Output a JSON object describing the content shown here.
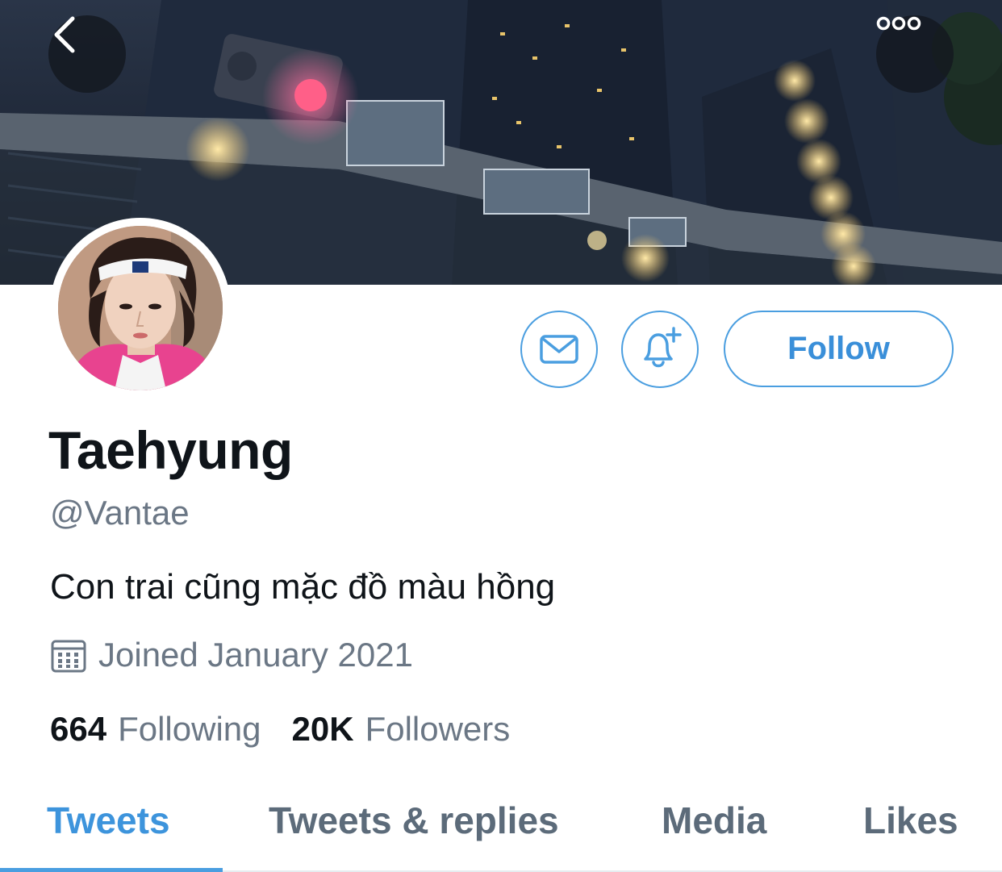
{
  "header": {
    "back_icon": "chevron-left-icon",
    "more_icon": "more-dots-icon"
  },
  "profile": {
    "display_name": "Taehyung",
    "handle": "@Vantae",
    "bio": "Con trai cũng mặc đồ màu hồng",
    "joined": "Joined January 2021",
    "following_count": "664",
    "following_label": "Following",
    "followers_count": "20K",
    "followers_label": "Followers"
  },
  "actions": {
    "message_icon": "envelope-icon",
    "notify_icon": "bell-plus-icon",
    "follow_label": "Follow"
  },
  "tabs": [
    {
      "label": "Tweets",
      "active": true
    },
    {
      "label": "Tweets & replies",
      "active": false
    },
    {
      "label": "Media",
      "active": false
    },
    {
      "label": "Likes",
      "active": false
    }
  ],
  "colors": {
    "accent": "#4a9ee0",
    "text_primary": "#0f1419",
    "text_secondary": "#6b7785"
  }
}
